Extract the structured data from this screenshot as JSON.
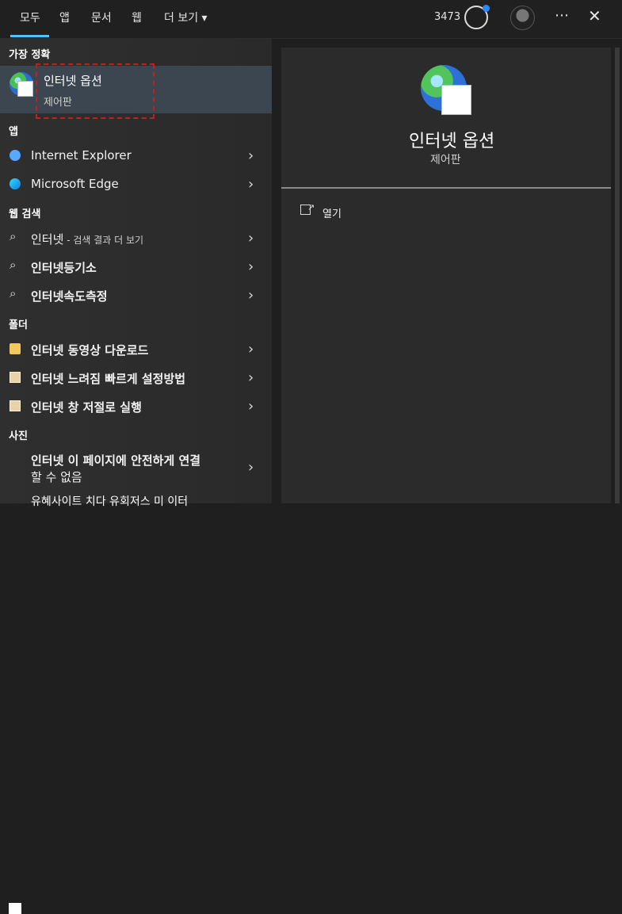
{
  "tabs": [
    {
      "label": "모두",
      "active": true
    },
    {
      "label": "앱",
      "active": false
    },
    {
      "label": "문서",
      "active": false
    },
    {
      "label": "웹",
      "active": false
    },
    {
      "label": "더 보기",
      "active": false
    }
  ],
  "header": {
    "points": "3473"
  },
  "sections": {
    "best_match": "가장 정확",
    "apps": "앱",
    "web_search": "웹 검색",
    "folders": "폴더",
    "photos": "사진"
  },
  "best_match": {
    "title": "인터넷 옵션",
    "subtitle": "제어판"
  },
  "apps": [
    {
      "label": "Internet Explorer",
      "icon": "internet-explorer-icon"
    },
    {
      "label": "Microsoft Edge",
      "icon": "edge-icon"
    }
  ],
  "web_search": [
    {
      "label": "인터넷",
      "suffix": " - 검색 결과 더 보기"
    },
    {
      "label": "인터넷등기소"
    },
    {
      "label": "인터넷속도측정"
    }
  ],
  "folders": [
    {
      "label": "인터넷 동영상 다운로드"
    },
    {
      "label": "인터넷 느려짐 빠르게 설정방법"
    },
    {
      "label": "인터넷 창 저절로 실행"
    }
  ],
  "photos": [
    {
      "line1": "인터넷 이 페이지에 안전하게 연결",
      "line2": "할 수 없음"
    }
  ],
  "bottom_partial": "유혜사이트 치다 유회저스 미 이터",
  "right_panel": {
    "title": "인터넷 옵션",
    "subtitle": "제어판",
    "action": "열기"
  },
  "colors": {
    "accent": "#4cc2ff",
    "selected_bg": "#3b4650",
    "dashed_highlight": "#c41e1e"
  }
}
